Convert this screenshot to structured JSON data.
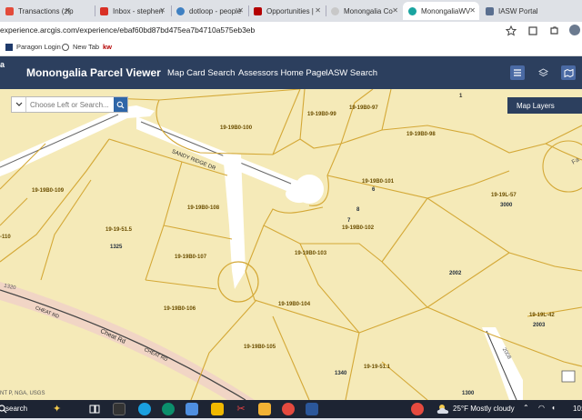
{
  "browser": {
    "tabs": [
      {
        "label": "Transactions (zip",
        "active": false
      },
      {
        "label": "Inbox - stephen",
        "active": false
      },
      {
        "label": "dotloop - people",
        "active": false
      },
      {
        "label": "Opportunities |",
        "active": false
      },
      {
        "label": "Monongalia Co",
        "active": false
      },
      {
        "label": "MonongaliaWV",
        "active": true
      },
      {
        "label": "IASW Portal",
        "active": false
      }
    ],
    "url": "experience.arcgis.com/experience/ebaf60bd87bd475ea7b4710a575eb3eb",
    "bookmarks": [
      {
        "label": "Paragon Login"
      },
      {
        "label": "New Tab"
      },
      {
        "label": "kw"
      }
    ]
  },
  "app": {
    "corner_label": "a",
    "title": "Monongalia Parcel Viewer",
    "nav": [
      "Map Card Search",
      "Assessors Home Page",
      "IASW Search"
    ],
    "tools": [
      "list-icon",
      "layers-icon",
      "basemap-icon"
    ]
  },
  "map": {
    "search_placeholder": "Choose Left or Search...",
    "map_layers_label": "Map Layers",
    "roads": {
      "sandy_ridge": "SANDY RIDGE DR",
      "cheat_rd": "Cheat Rd",
      "cheat_rd_caps": "CHEAT RD",
      "cheat_rd_caps_2": "CHEAT RD",
      "route_1320": "1320",
      "route_2008": "2008",
      "route_fa": "Fa"
    },
    "parcels": [
      {
        "id": "19-19B0-100"
      },
      {
        "id": "19-19B0-99"
      },
      {
        "id": "19-19B0-97"
      },
      {
        "id": "19-19B0-98"
      },
      {
        "id": "19-19B0-101"
      },
      {
        "id": "19-19B0-102"
      },
      {
        "id": "19-19B0-109"
      },
      {
        "id": "19-19B0-108"
      },
      {
        "id": "19-19B0-107"
      },
      {
        "id": "19-19B0-106"
      },
      {
        "id": "19-19B0-105"
      },
      {
        "id": "19-19B0-104"
      },
      {
        "id": "19-19B0-103"
      },
      {
        "id": "19-19-51.5"
      },
      {
        "id": "19-19-51.1"
      },
      {
        "id": "19-19L-57"
      },
      {
        "id": "19-19L-42"
      },
      {
        "id": "-110"
      },
      {
        "id": "1"
      }
    ],
    "addresses": [
      "3000",
      "1325",
      "2002",
      "2003",
      "1340",
      "6",
      "7",
      "8",
      "1300"
    ],
    "attribution": "NT P, NGA, USGS"
  },
  "taskbar": {
    "search_label": "search",
    "weather": "25°F  Mostly cloudy",
    "time": "10:"
  }
}
